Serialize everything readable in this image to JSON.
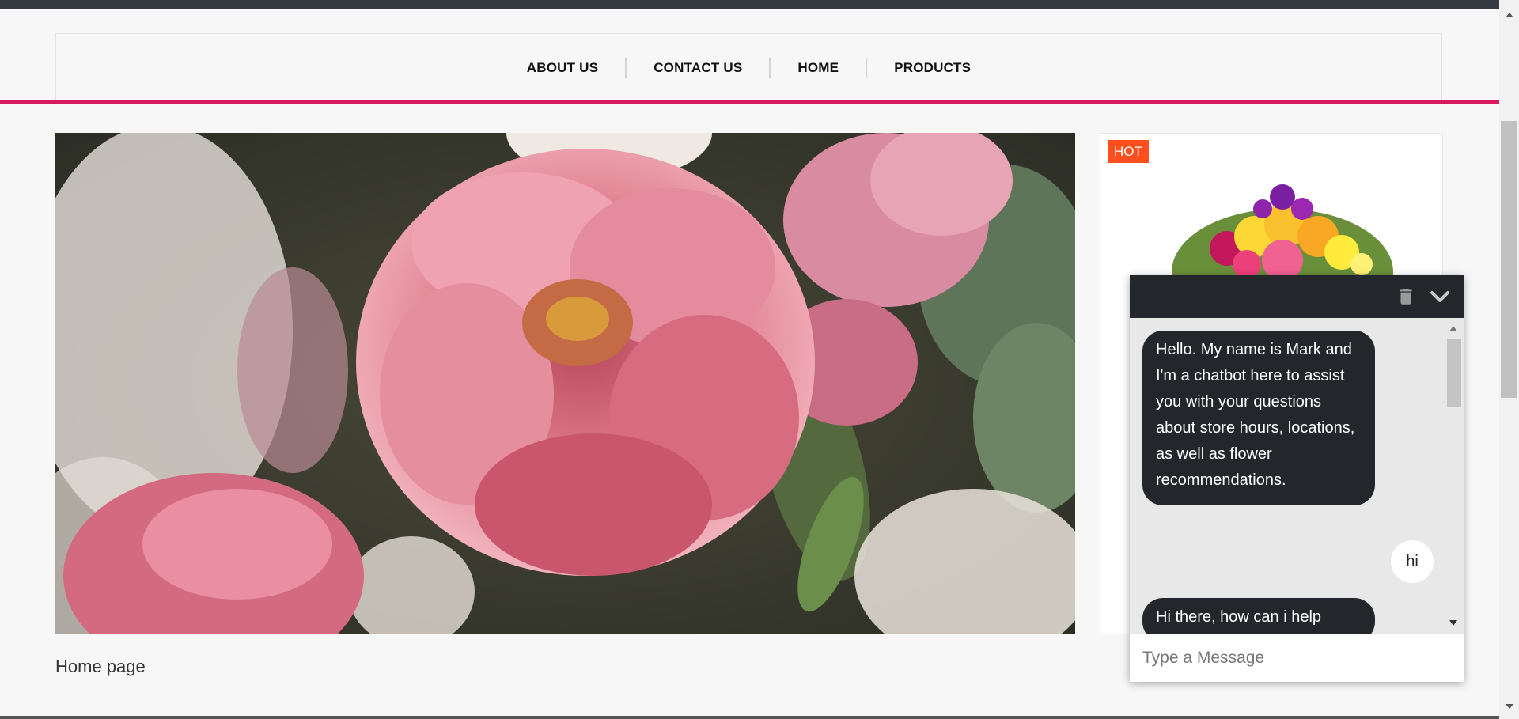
{
  "nav": {
    "items": [
      {
        "label": "ABOUT US"
      },
      {
        "label": "CONTACT US"
      },
      {
        "label": "HOME"
      },
      {
        "label": "PRODUCTS"
      }
    ]
  },
  "hero": {
    "alt_subject": "pink peonies bouquet"
  },
  "page": {
    "caption": "Home page"
  },
  "product": {
    "badge": "HOT"
  },
  "chat": {
    "messages": [
      {
        "sender": "bot",
        "text": "Hello. My name is Mark and I'm a chatbot here to assist you with your questions about store hours, locations, as well as flower recommendations."
      },
      {
        "sender": "user",
        "text": "hi"
      },
      {
        "sender": "bot",
        "text": "Hi there, how can i help"
      }
    ],
    "input_placeholder": "Type a Message",
    "icons": {
      "clear": "trash-icon",
      "minimize": "chevron-down-icon"
    }
  },
  "colors": {
    "accent": "#d81b60",
    "chat_dark": "#23272b",
    "hot_badge": "#ff4f1e",
    "topbar": "#343a40"
  }
}
